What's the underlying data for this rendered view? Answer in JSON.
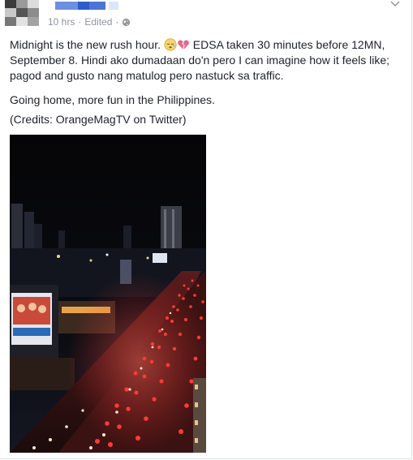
{
  "post": {
    "timestamp": "10 hrs",
    "separator": " · ",
    "edited_label": "Edited",
    "separator2": " · ",
    "body_line1a": "Midnight is the new rush hour. ",
    "body_line1b": " EDSA taken 30 minutes before 12MN, September 8. Hindi ako dumadaan do'n pero I can imagine how it feels like; pagod and gusto nang matulog pero nastuck sa traffic.",
    "paragraph2": "Going home, more fun in the Philippines.",
    "paragraph3": "(Credits: OrangeMagTV on Twitter)",
    "icons": [
      "avatar",
      "privacy-globe-icon",
      "options-chevron-icon",
      "sleepy-emoji-icon",
      "broken-heart-emoji-icon"
    ]
  },
  "colors": {
    "meta_text": "#90949c",
    "body_text": "#1d2129",
    "border": "#dddfe2",
    "traffic_red": "#e8252a"
  }
}
